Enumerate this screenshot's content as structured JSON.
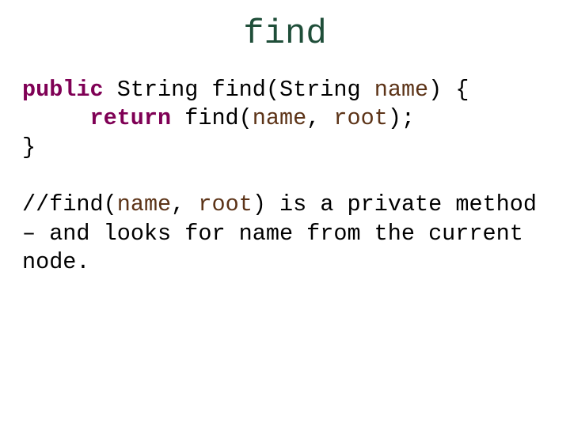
{
  "title": "find",
  "code": {
    "kw_public": "public",
    "type_string1": "String",
    "fn_find": "find",
    "lparen1": "(",
    "type_string2": "String",
    "param_name1": "name",
    "rparen_brace": ") {",
    "kw_return": "return",
    "call_find": "find",
    "lparen2": "(",
    "arg_name": "name",
    "comma1": ", ",
    "arg_root": "root",
    "rparen_semi": ");",
    "close_brace": "}"
  },
  "comment": {
    "slashes": "//",
    "fn": "find",
    "lparen": "(",
    "p_name": "name",
    "comma": ", ",
    "p_root": "root",
    "rparen": ")",
    "tail": " is a private method – and looks for name from the current node."
  }
}
